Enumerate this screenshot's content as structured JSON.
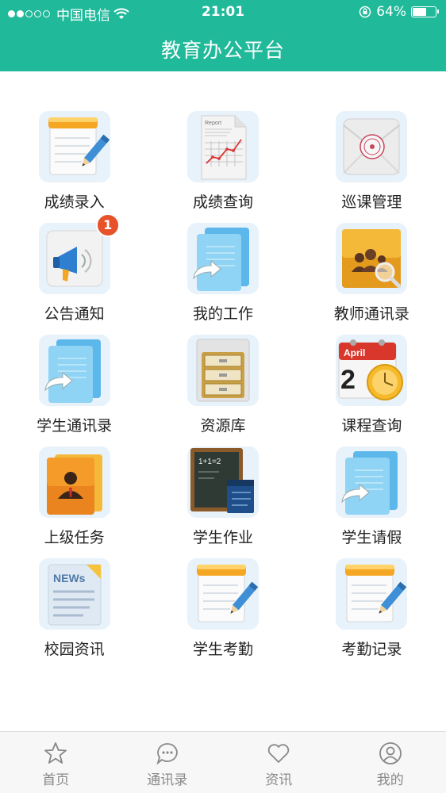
{
  "status_bar": {
    "carrier": "中国电信",
    "time": "21:01",
    "battery": "64%",
    "battery_level": 0.64
  },
  "header": {
    "title": "教育办公平台"
  },
  "colors": {
    "brand": "#20b99a",
    "badge": "#e8522a"
  },
  "grid": [
    {
      "label": "成绩录入",
      "icon": "notepad-pencil-icon"
    },
    {
      "label": "成绩查询",
      "icon": "report-chart-icon"
    },
    {
      "label": "巡课管理",
      "icon": "envelope-stamp-icon"
    },
    {
      "label": "公告通知",
      "icon": "megaphone-icon",
      "badge": "1"
    },
    {
      "label": "我的工作",
      "icon": "folder-arrow-icon"
    },
    {
      "label": "教师通讯录",
      "icon": "people-search-icon"
    },
    {
      "label": "学生通讯录",
      "icon": "folder-arrow-icon"
    },
    {
      "label": "资源库",
      "icon": "file-cabinet-icon"
    },
    {
      "label": "课程查询",
      "icon": "calendar-clock-icon"
    },
    {
      "label": "上级任务",
      "icon": "contact-book-icon"
    },
    {
      "label": "学生作业",
      "icon": "chalkboard-icon"
    },
    {
      "label": "学生请假",
      "icon": "folder-arrow-icon"
    },
    {
      "label": "校园资讯",
      "icon": "newspaper-icon"
    },
    {
      "label": "学生考勤",
      "icon": "notepad-pencil-icon"
    },
    {
      "label": "考勤记录",
      "icon": "notepad-pencil-icon"
    }
  ],
  "tabbar": [
    {
      "label": "首页",
      "icon": "star-icon"
    },
    {
      "label": "通讯录",
      "icon": "chat-bubble-icon"
    },
    {
      "label": "资讯",
      "icon": "heart-icon"
    },
    {
      "label": "我的",
      "icon": "user-circle-icon"
    }
  ]
}
